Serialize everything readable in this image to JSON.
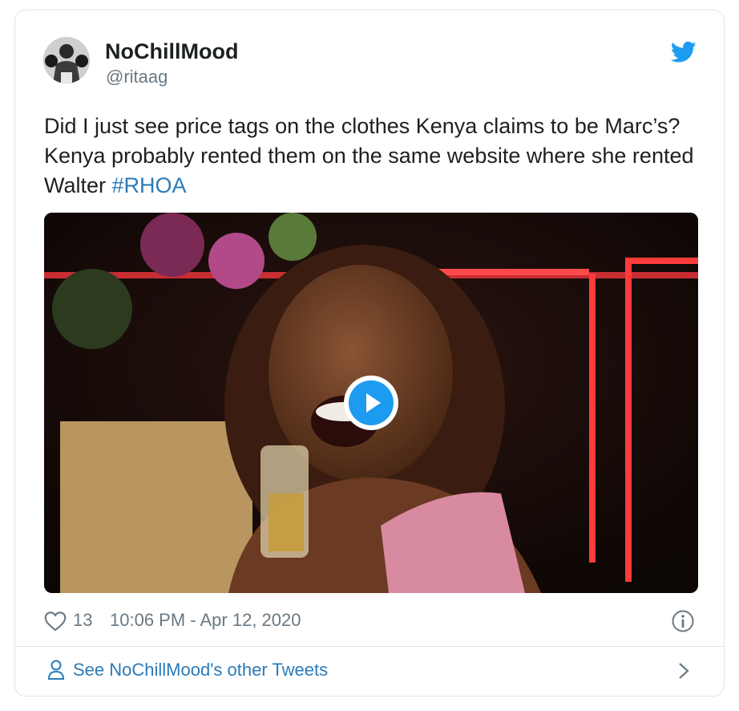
{
  "tweet": {
    "author": {
      "display_name": "NoChillMood",
      "handle": "@ritaag",
      "avatar_icon": "boxer-avatar-photo"
    },
    "text_main": "Did I just see price tags on the clothes Kenya claims to be Marc’s? Kenya probably rented them on the same website where she rented Walter ",
    "hashtag": "#RHOA",
    "media": {
      "type": "video",
      "play_icon": "play-icon"
    },
    "likes": "13",
    "timestamp": "10:06 PM - Apr 12, 2020",
    "footer_link": "See NoChillMood's other Tweets"
  },
  "colors": {
    "brand": "#1d9bf0",
    "link": "#2b7bb9",
    "muted": "#697882",
    "text": "#1c2022",
    "border": "#dfe3e7"
  },
  "icons": [
    "twitter-bird-icon",
    "heart-icon",
    "info-icon",
    "user-icon",
    "chevron-right-icon"
  ]
}
